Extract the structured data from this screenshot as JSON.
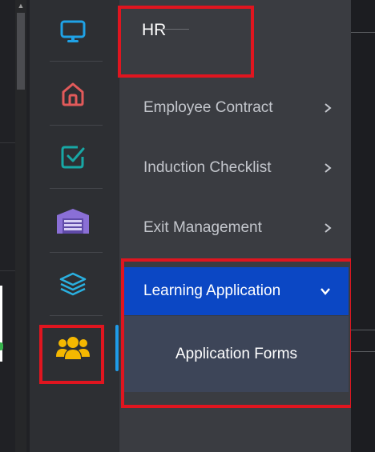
{
  "colors": {
    "accent_blue": "#0b47c4",
    "rail_indicator": "#1f9be8",
    "annotation_red": "#e0151f"
  },
  "rail": {
    "items": [
      {
        "icon": "monitor-icon",
        "color": "#1fa2e6"
      },
      {
        "icon": "home-icon",
        "color": "#e25a5a"
      },
      {
        "icon": "checkbox-icon",
        "color": "#18a7a5"
      },
      {
        "icon": "warehouse-icon",
        "color": "#8a6fd6"
      },
      {
        "icon": "layers-icon",
        "color": "#2ab0e0"
      },
      {
        "icon": "users-icon",
        "color": "#f5b800"
      }
    ]
  },
  "submenu": {
    "title": "HR",
    "items": [
      {
        "label": "Employee Contract"
      },
      {
        "label": "Induction Checklist"
      },
      {
        "label": "Exit Management"
      },
      {
        "label": "Learning Application",
        "expanded": true
      }
    ],
    "children": [
      {
        "label": "Application Forms"
      }
    ]
  }
}
